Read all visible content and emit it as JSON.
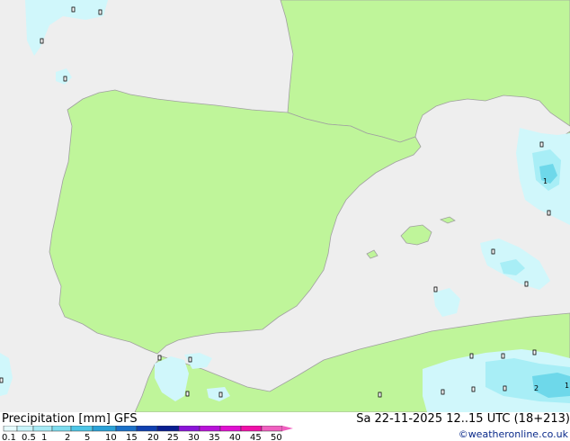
{
  "header": {
    "title_left": "Precipitation [mm] GFS",
    "title_right": "Sa 22-11-2025 12..15 UTC (18+213)",
    "credit": "©weatheronline.co.uk"
  },
  "colors": {
    "sea": "#eeeeee",
    "land": "#bff59a",
    "border": "#a0a0a0",
    "precip_light": "#d0f7fb",
    "precip_mid": "#a8eef6",
    "precip_strong": "#6ed8ea"
  },
  "legend": {
    "labels": [
      "0.1",
      "0.5",
      "1",
      "2",
      "5",
      "10",
      "15",
      "20",
      "25",
      "30",
      "35",
      "40",
      "45",
      "50"
    ],
    "colors": [
      "#e6fbfd",
      "#c8f4fa",
      "#a6eaf5",
      "#7ddcee",
      "#4ec6e6",
      "#2aa2d8",
      "#1a70c8",
      "#1040b0",
      "#0a1e90",
      "#8a14d8",
      "#b812d8",
      "#e010d0",
      "#f010a8",
      "#f060c0"
    ]
  },
  "precip_labels": [
    {
      "text": "1",
      "region": "eastern-mediterranean-west"
    },
    {
      "text": "2",
      "region": "algerian-coast-east"
    },
    {
      "text": "1",
      "region": "algerian-coast-east-edge"
    }
  ]
}
